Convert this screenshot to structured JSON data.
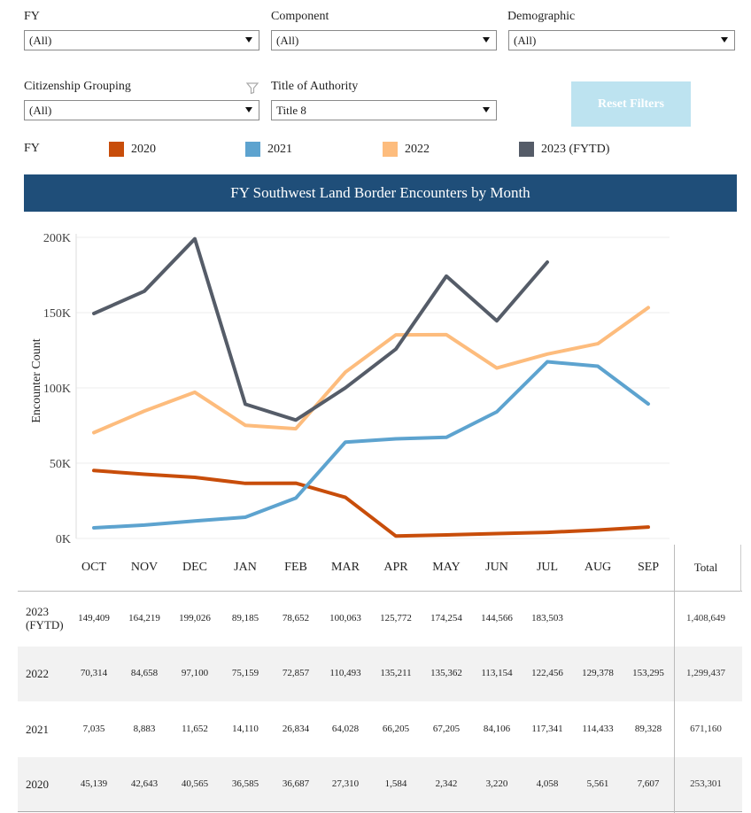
{
  "filters": {
    "fy": {
      "label": "FY",
      "value": "(All)"
    },
    "component": {
      "label": "Component",
      "value": "(All)"
    },
    "demographic": {
      "label": "Demographic",
      "value": "(All)"
    },
    "citizenship": {
      "label": "Citizenship Grouping",
      "value": "(All)"
    },
    "authority": {
      "label": "Title of Authority",
      "value": "Title 8"
    },
    "reset_label": "Reset Filters"
  },
  "legend": {
    "title": "FY",
    "items": [
      {
        "label": "2020",
        "color": "#c84d0a"
      },
      {
        "label": "2021",
        "color": "#5da3cf"
      },
      {
        "label": "2022",
        "color": "#fdbc7d"
      },
      {
        "label": "2023 (FYTD)",
        "color": "#555c68"
      }
    ]
  },
  "chart_data": {
    "type": "line",
    "title": "FY Southwest Land Border Encounters by Month",
    "xlabel": "",
    "ylabel": "Encounter Count",
    "categories": [
      "OCT",
      "NOV",
      "DEC",
      "JAN",
      "FEB",
      "MAR",
      "APR",
      "MAY",
      "JUN",
      "JUL",
      "AUG",
      "SEP"
    ],
    "ylim": [
      0,
      200000
    ],
    "yticks": [
      0,
      50000,
      100000,
      150000,
      200000
    ],
    "ytick_labels": [
      "0K",
      "50K",
      "100K",
      "150K",
      "200K"
    ],
    "grid": true,
    "series": [
      {
        "name": "2020",
        "color": "#c84d0a",
        "values": [
          45139,
          42643,
          40565,
          36585,
          36687,
          27310,
          1584,
          2342,
          3220,
          4058,
          5561,
          7607
        ]
      },
      {
        "name": "2021",
        "color": "#5da3cf",
        "values": [
          7035,
          8883,
          11652,
          14110,
          26834,
          64028,
          66205,
          67205,
          84106,
          117341,
          114433,
          89328
        ]
      },
      {
        "name": "2022",
        "color": "#fdbc7d",
        "values": [
          70314,
          84658,
          97100,
          75159,
          72857,
          110493,
          135211,
          135362,
          113154,
          122456,
          129378,
          153295
        ]
      },
      {
        "name": "2023 (FYTD)",
        "color": "#555c68",
        "values": [
          149409,
          164219,
          199026,
          89185,
          78652,
          100063,
          125772,
          174254,
          144566,
          183503,
          null,
          null
        ]
      }
    ]
  },
  "table": {
    "columns": [
      "OCT",
      "NOV",
      "DEC",
      "JAN",
      "FEB",
      "MAR",
      "APR",
      "MAY",
      "JUN",
      "JUL",
      "AUG",
      "SEP",
      "Total"
    ],
    "rows": [
      {
        "label": [
          "2023",
          "(FYTD)"
        ],
        "values": [
          "149,409",
          "164,219",
          "199,026",
          "89,185",
          "78,652",
          "100,063",
          "125,772",
          "174,254",
          "144,566",
          "183,503",
          "",
          "",
          "1,408,649"
        ]
      },
      {
        "label": [
          "2022"
        ],
        "values": [
          "70,314",
          "84,658",
          "97,100",
          "75,159",
          "72,857",
          "110,493",
          "135,211",
          "135,362",
          "113,154",
          "122,456",
          "129,378",
          "153,295",
          "1,299,437"
        ]
      },
      {
        "label": [
          "2021"
        ],
        "values": [
          "7,035",
          "8,883",
          "11,652",
          "14,110",
          "26,834",
          "64,028",
          "66,205",
          "67,205",
          "84,106",
          "117,341",
          "114,433",
          "89,328",
          "671,160"
        ]
      },
      {
        "label": [
          "2020"
        ],
        "values": [
          "45,139",
          "42,643",
          "40,565",
          "36,585",
          "36,687",
          "27,310",
          "1,584",
          "2,342",
          "3,220",
          "4,058",
          "5,561",
          "7,607",
          "253,301"
        ]
      }
    ]
  }
}
